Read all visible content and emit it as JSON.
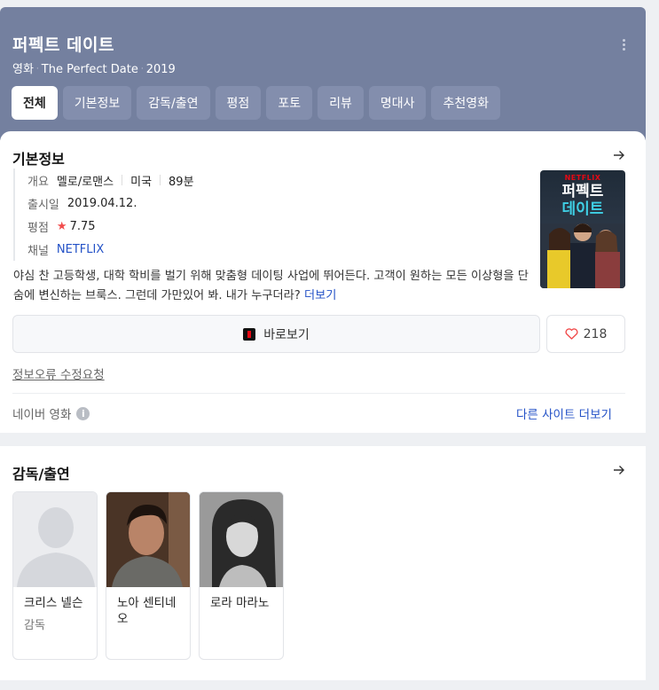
{
  "header": {
    "title": "퍼펙트 데이트",
    "category": "영화",
    "original_title": "The Perfect Date",
    "year": "2019",
    "tabs": [
      {
        "label": "전체",
        "active": true
      },
      {
        "label": "기본정보"
      },
      {
        "label": "감독/출연"
      },
      {
        "label": "평점"
      },
      {
        "label": "포토"
      },
      {
        "label": "리뷰"
      },
      {
        "label": "명대사"
      },
      {
        "label": "추천영화"
      }
    ]
  },
  "basic_info": {
    "section_title": "기본정보",
    "overview_label": "개요",
    "genre": "멜로/로맨스",
    "country": "미국",
    "runtime": "89분",
    "release_label": "출시일",
    "release_date": "2019.04.12.",
    "rating_label": "평점",
    "rating_star": "★",
    "rating_value": "7.75",
    "channel_label": "채널",
    "channel_value": "NETFLIX",
    "poster": {
      "brand": "NETFLIX",
      "title_line1": "퍼펙트",
      "title_line2": "데이트"
    },
    "synopsis": "야심 찬 고등학생, 대학 학비를 벌기 위해 맞춤형 데이팅 사업에 뛰어든다. 고객이 원하는 모든 이상형을 단숨에 변신하는 브룩스. 그런데 가만있어 봐. 내가 누구더라?",
    "more_label": "더보기",
    "watch_label": "바로보기",
    "like_count": "218",
    "report_label": "정보오류 수정요청",
    "source_label": "네이버 영화",
    "info_icon_glyph": "i",
    "other_sites_label": "다른 사이트 더보기"
  },
  "cast": {
    "section_title": "감독/출연",
    "people": [
      {
        "name": "크리스 넬슨",
        "role": "감독",
        "photo": "placeholder-silhouette"
      },
      {
        "name": "노아 센티네오",
        "role": "",
        "photo": "portrait"
      },
      {
        "name": "로라 마라노",
        "role": "",
        "photo": "portrait-bw"
      }
    ]
  },
  "colors": {
    "header_bg": "#74809f",
    "tab_bg": "#838ead",
    "link": "#2452c7",
    "star": "#f14c4c",
    "netflix_red": "#e50914"
  }
}
